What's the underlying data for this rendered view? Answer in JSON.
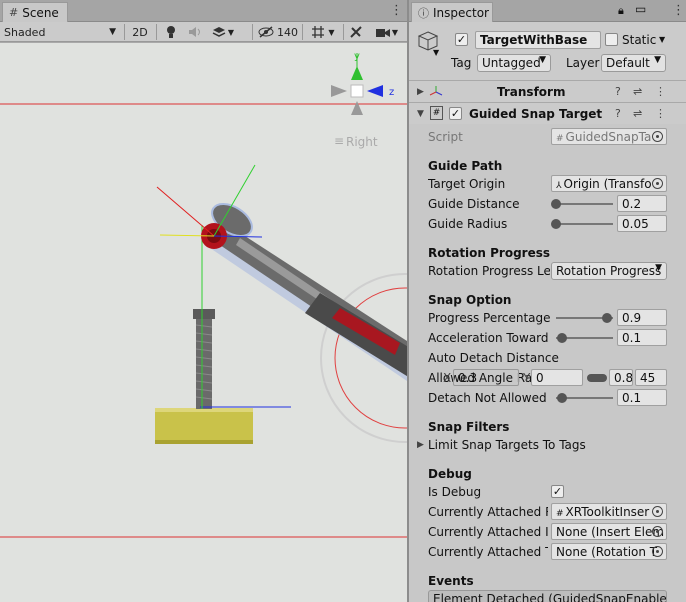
{
  "scene": {
    "tab_title": "Scene",
    "tab_icon": "hash-icon",
    "shading_mode": "Shaded",
    "toggle_2d": "2D",
    "visibility_count": "140",
    "view_label": "Right"
  },
  "inspector": {
    "tab_title": "Inspector",
    "object": {
      "name": "TargetWithBase",
      "static_label": "Static",
      "tag_label": "Tag",
      "tag_value": "Untagged",
      "layer_label": "Layer",
      "layer_value": "Default"
    },
    "transform": {
      "title": "Transform"
    },
    "component": {
      "title": "Guided Snap Target (Sc",
      "script_label": "Script",
      "script_value": "GuidedSnapTa",
      "guide_path_header": "Guide Path",
      "target_origin_label": "Target Origin",
      "target_origin_value": "Origin (Transfo",
      "guide_distance_label": "Guide Distance",
      "guide_distance_value": "0.2",
      "guide_distance_level": 0,
      "guide_radius_label": "Guide Radius",
      "guide_radius_value": "0.05",
      "guide_radius_level": 0,
      "rotation_progress_header": "Rotation Progress",
      "rotation_progress_len_label": "Rotation Progress Len",
      "rotation_progress_len_value": "Rotation Progress",
      "snap_option_header": "Snap Option",
      "progress_percentage_label": "Progress Percentage",
      "progress_percentage_value": "0.9",
      "progress_percentage_level": 0.9,
      "acceleration_label": "Acceleration Towards",
      "acceleration_value": "0.1",
      "acceleration_level": 0.1,
      "auto_detach_label": "Auto Detach Distance",
      "allowed_angle_label": "Allowed Angle Range",
      "angle_x_label": "X",
      "angle_x_value": "0.3",
      "angle_y_label": "Y",
      "angle_y_value": "0",
      "angle_z_value": "0.8",
      "angle_w_value": "45",
      "detach_not_allowed_label": "Detach Not Allowed I",
      "detach_not_allowed_value": "0.1",
      "detach_not_allowed_level": 0.1,
      "snap_filters_header": "Snap Filters",
      "limit_snap_label": "Limit Snap Targets To Tags",
      "debug_header": "Debug",
      "is_debug_label": "Is Debug",
      "is_debug_checked": "✓",
      "attached_r_label": "Currently Attached Ri",
      "attached_r_value": "XRToolkitInser",
      "attached_in_label": "Currently Attached In",
      "attached_in_value": "None (Insert Elem",
      "attached_t_label": "Currently Attached Ta",
      "attached_t_value": "None (Rotation T",
      "events_header": "Events",
      "events_first_item": "Element Detached (GuidedSnapEnabled"
    }
  },
  "colors": {
    "viewport_bg": "#e0e2df",
    "wrench_body": "#6b6b6b",
    "socket_red": "#b3121c",
    "base_yellow": "#c9c24a",
    "axis_red": "#e02020",
    "axis_green": "#30d030",
    "axis_blue": "#2030e0"
  }
}
